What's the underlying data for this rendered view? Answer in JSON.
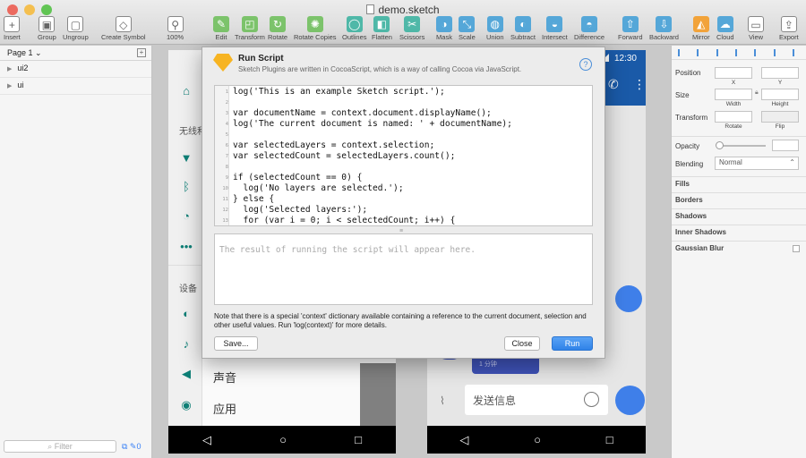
{
  "window": {
    "title": "demo.sketch",
    "traffic_lights": [
      "#ec6a5f",
      "#f4bf4f",
      "#61c554"
    ]
  },
  "toolbar": {
    "items": [
      {
        "label": "Insert",
        "icon": "plus-icon"
      },
      {
        "label": "Group",
        "icon": "group-icon"
      },
      {
        "label": "Ungroup",
        "icon": "ungroup-icon"
      },
      {
        "label": "Create Symbol",
        "icon": "symbol-icon"
      },
      {
        "label": "100%",
        "icon": "zoom-icon"
      },
      {
        "label": "Edit",
        "icon": "edit-icon"
      },
      {
        "label": "Transform",
        "icon": "transform-icon"
      },
      {
        "label": "Rotate",
        "icon": "rotate-icon"
      },
      {
        "label": "Rotate Copies",
        "icon": "rotate-copies-icon"
      },
      {
        "label": "Outlines",
        "icon": "outlines-icon"
      },
      {
        "label": "Flatten",
        "icon": "flatten-icon"
      },
      {
        "label": "Scissors",
        "icon": "scissors-icon"
      },
      {
        "label": "Mask",
        "icon": "mask-icon"
      },
      {
        "label": "Scale",
        "icon": "scale-icon"
      },
      {
        "label": "Union",
        "icon": "union-icon"
      },
      {
        "label": "Subtract",
        "icon": "subtract-icon"
      },
      {
        "label": "Intersect",
        "icon": "intersect-icon"
      },
      {
        "label": "Difference",
        "icon": "difference-icon"
      },
      {
        "label": "Forward",
        "icon": "forward-icon"
      },
      {
        "label": "Backward",
        "icon": "backward-icon"
      },
      {
        "label": "Mirror",
        "icon": "mirror-icon"
      },
      {
        "label": "Cloud",
        "icon": "cloud-icon"
      },
      {
        "label": "View",
        "icon": "view-icon"
      },
      {
        "label": "Export",
        "icon": "export-icon"
      }
    ]
  },
  "layers_panel": {
    "page_selector": "Page 1 ⌄",
    "layers": [
      "ui2",
      "ui"
    ],
    "filter_placeholder": "Filter",
    "filter_count": "0"
  },
  "canvas": {
    "phone1": {
      "section1": "无线和",
      "section2": "设备",
      "items": [
        "声音",
        "应用"
      ]
    },
    "phone2": {
      "time": "12:30",
      "message_placeholder": "发送信息",
      "bubble_text": "1 分钟"
    }
  },
  "inspector": {
    "position_label": "Position",
    "size_label": "Size",
    "transform_label": "Transform",
    "opacity_label": "Opacity",
    "blending_label": "Blending",
    "blending_value": "Normal",
    "sub_x": "X",
    "sub_y": "Y",
    "sub_width": "Width",
    "sub_height": "Height",
    "sub_rotate": "Rotate",
    "sub_flip": "Flip",
    "sections": [
      "Fills",
      "Borders",
      "Shadows",
      "Inner Shadows",
      "Gaussian Blur"
    ]
  },
  "dialog": {
    "title": "Run Script",
    "subtitle": "Sketch Plugins are written in CocoaScript, which is a way of calling Cocoa via JavaScript.",
    "code_lines": [
      "log('This is an example Sketch script.');",
      "",
      "var documentName = context.document.displayName();",
      "log('The current document is named: ' + documentName);",
      "",
      "var selectedLayers = context.selection;",
      "var selectedCount = selectedLayers.count();",
      "",
      "if (selectedCount == 0) {",
      "  log('No layers are selected.');",
      "} else {",
      "  log('Selected layers:');",
      "  for (var i = 0; i < selectedCount; i++) {"
    ],
    "result_placeholder": "The result of running the script will appear here.",
    "note": "Note that there is a special 'context' dictionary available containing a reference to the current document, selection and other useful values. Run 'log(context)' for more details.",
    "save_label": "Save...",
    "close_label": "Close",
    "run_label": "Run"
  }
}
